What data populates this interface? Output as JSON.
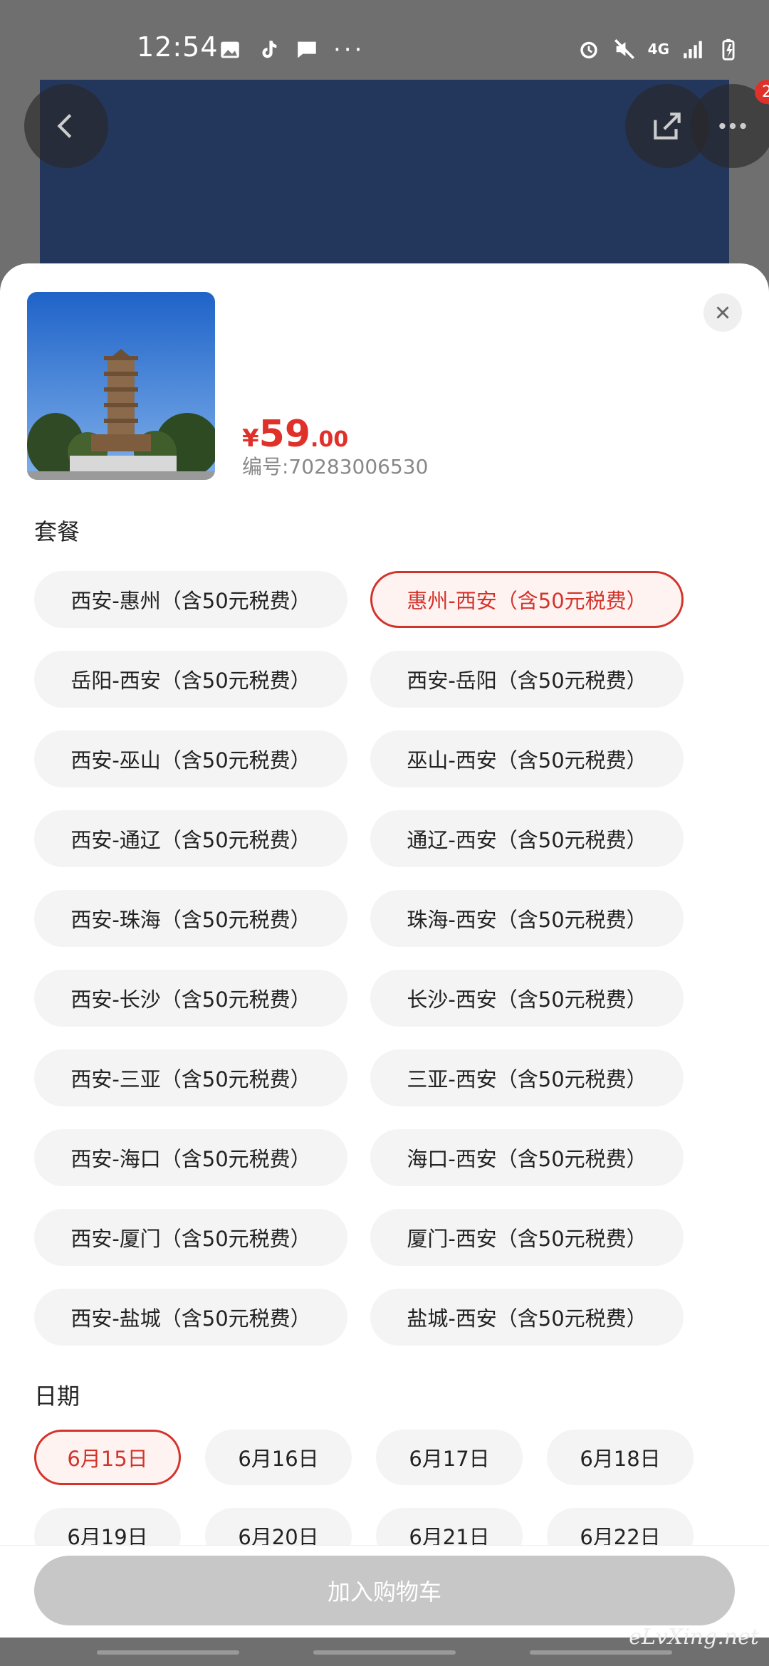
{
  "status_bar": {
    "time": "12:54",
    "network": "4G"
  },
  "header": {
    "badge_count": "2"
  },
  "product": {
    "price_symbol": "¥",
    "price_int": "59",
    "price_dec": ".00",
    "code": "编号:70283006530"
  },
  "package": {
    "title": "套餐",
    "options": [
      {
        "label": "西安-惠州（含50元税费）",
        "selected": false
      },
      {
        "label": "惠州-西安（含50元税费）",
        "selected": true
      },
      {
        "label": "岳阳-西安（含50元税费）",
        "selected": false
      },
      {
        "label": "西安-岳阳（含50元税费）",
        "selected": false
      },
      {
        "label": "西安-巫山（含50元税费）",
        "selected": false
      },
      {
        "label": "巫山-西安（含50元税费）",
        "selected": false
      },
      {
        "label": "西安-通辽（含50元税费）",
        "selected": false
      },
      {
        "label": "通辽-西安（含50元税费）",
        "selected": false
      },
      {
        "label": "西安-珠海（含50元税费）",
        "selected": false
      },
      {
        "label": "珠海-西安（含50元税费）",
        "selected": false
      },
      {
        "label": "西安-长沙（含50元税费）",
        "selected": false
      },
      {
        "label": "长沙-西安（含50元税费）",
        "selected": false
      },
      {
        "label": "西安-三亚（含50元税费）",
        "selected": false
      },
      {
        "label": "三亚-西安（含50元税费）",
        "selected": false
      },
      {
        "label": "西安-海口（含50元税费）",
        "selected": false
      },
      {
        "label": "海口-西安（含50元税费）",
        "selected": false
      },
      {
        "label": "西安-厦门（含50元税费）",
        "selected": false
      },
      {
        "label": "厦门-西安（含50元税费）",
        "selected": false
      },
      {
        "label": "西安-盐城（含50元税费）",
        "selected": false
      },
      {
        "label": "盐城-西安（含50元税费）",
        "selected": false
      }
    ]
  },
  "date": {
    "title": "日期",
    "options": [
      {
        "label": "6月15日",
        "selected": true
      },
      {
        "label": "6月16日",
        "selected": false
      },
      {
        "label": "6月17日",
        "selected": false
      },
      {
        "label": "6月18日",
        "selected": false
      },
      {
        "label": "6月19日",
        "selected": false
      },
      {
        "label": "6月20日",
        "selected": false
      },
      {
        "label": "6月21日",
        "selected": false
      },
      {
        "label": "6月22日",
        "selected": false
      }
    ]
  },
  "footer": {
    "add_to_cart_label": "加入购物车"
  },
  "watermark": "eLvXing.net",
  "colors": {
    "accent": "#d2342b",
    "hero": "#23365c",
    "disabled_button": "#c7c7c7"
  }
}
